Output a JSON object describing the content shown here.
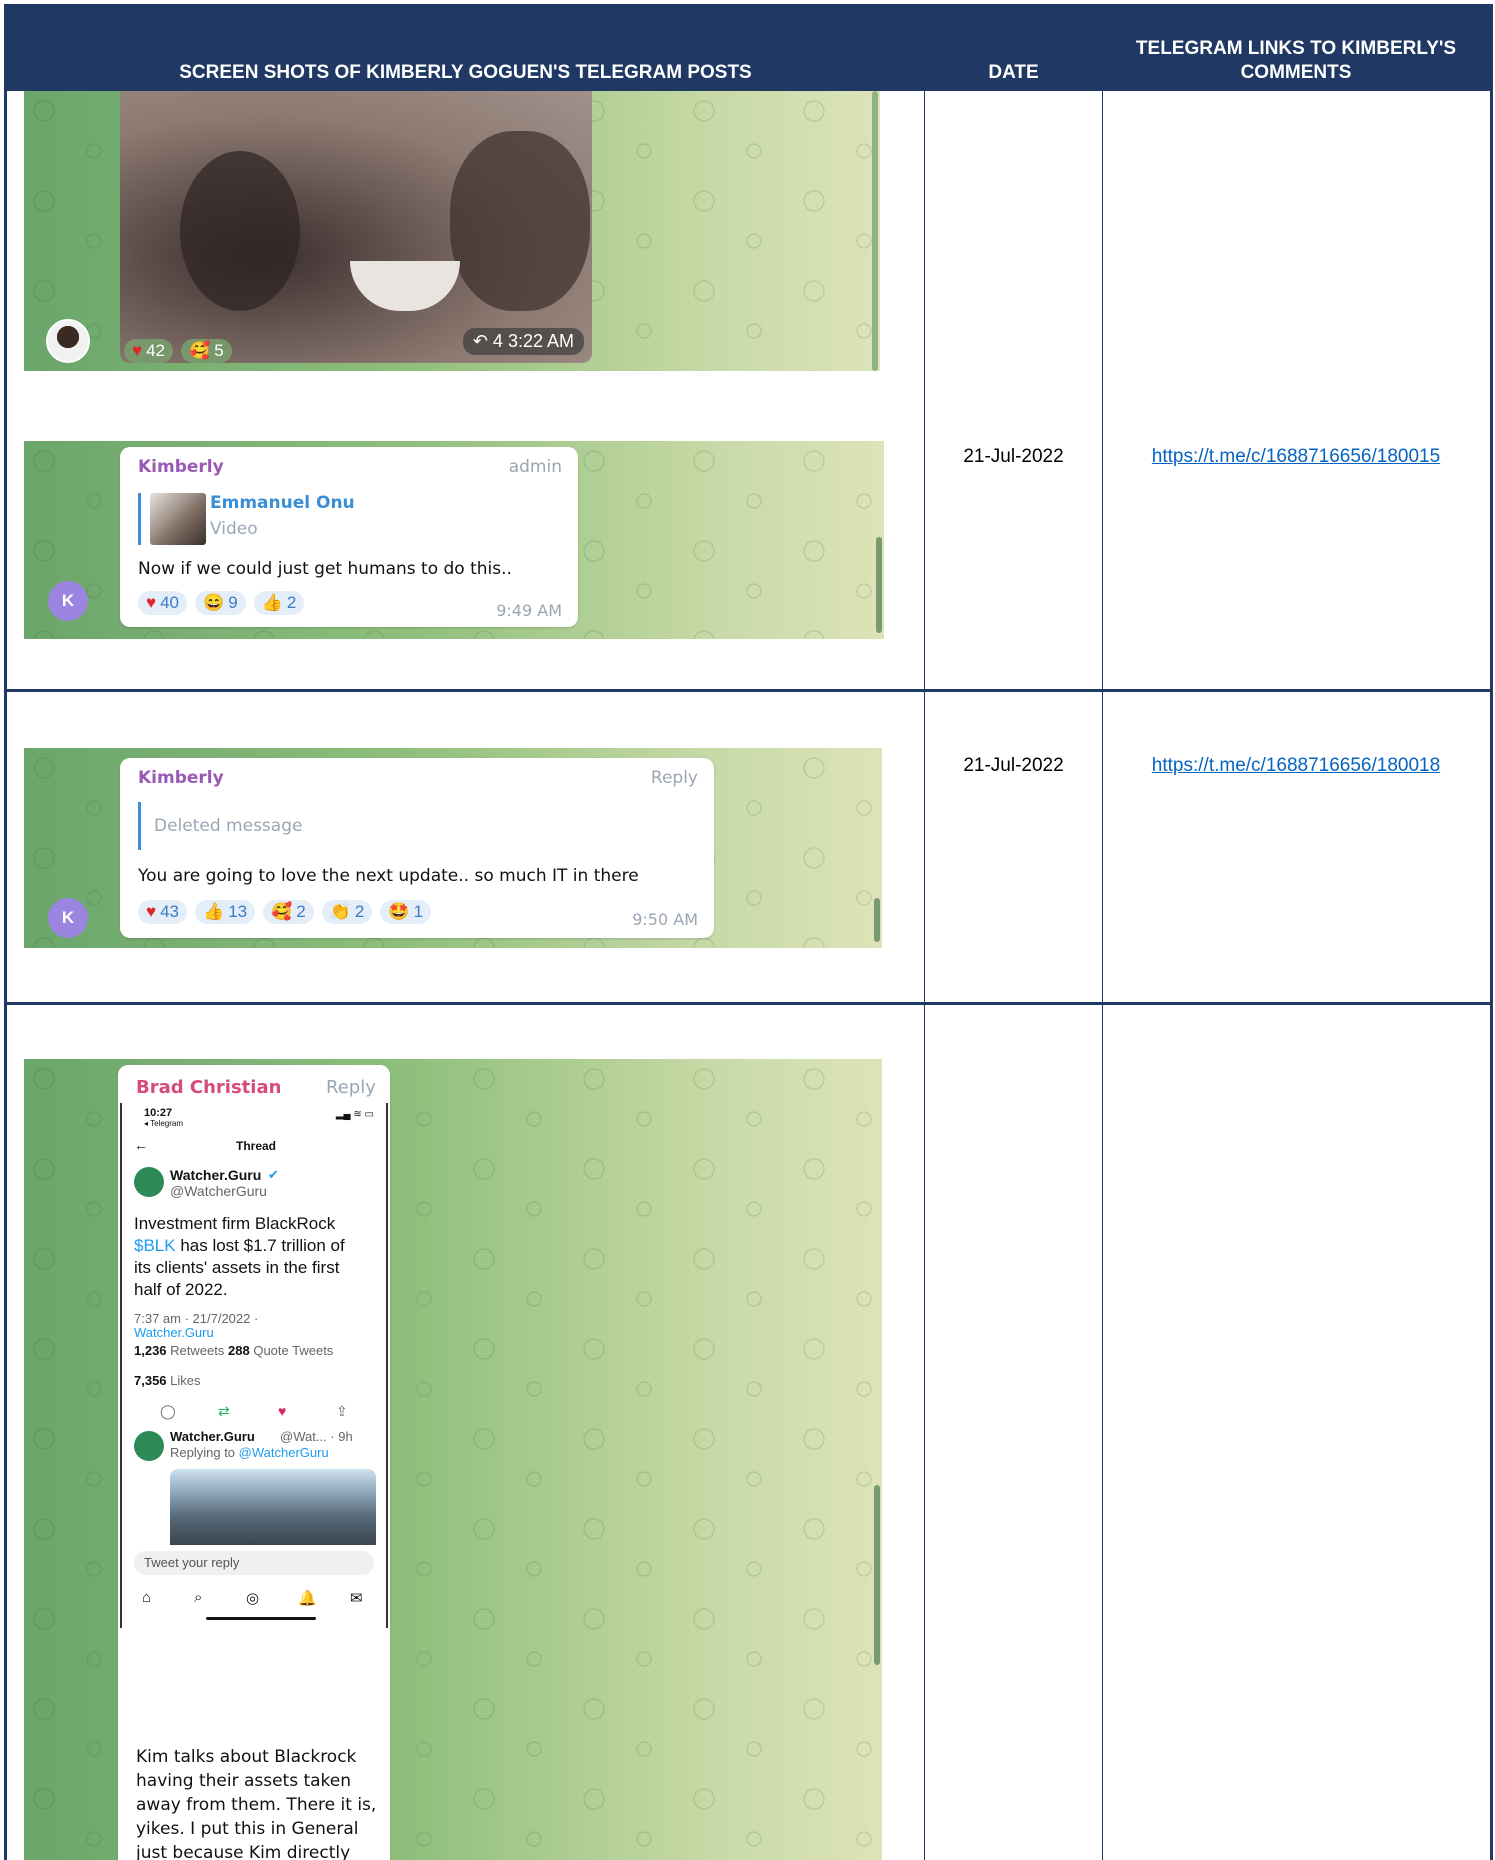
{
  "header": {
    "col1": "SCREEN SHOTS OF KIMBERLY GOGUEN'S TELEGRAM POSTS",
    "col2": "DATE",
    "col3": "TELEGRAM LINKS TO KIMBERLY'S COMMENTS"
  },
  "rows": [
    {
      "date": "21-Jul-2022",
      "link": "https://t.me/c/1688716656/180015",
      "video": {
        "forwards": "4",
        "time": "3:22 AM",
        "react_heart": "42",
        "react_2": "5"
      },
      "message": {
        "author": "Kimberly",
        "tag": "admin",
        "quote_name": "Emmanuel Onu",
        "quote_type": "Video",
        "text": "Now if we could just get humans to do this..",
        "time": "9:49 AM",
        "avatar_letter": "K",
        "reactions": [
          {
            "emoji": "♥",
            "count": "40"
          },
          {
            "emoji": "😄",
            "count": "9"
          },
          {
            "emoji": "👍",
            "count": "2"
          }
        ]
      }
    },
    {
      "date": "21-Jul-2022",
      "link": "https://t.me/c/1688716656/180018",
      "message": {
        "author": "Kimberly",
        "tag": "Reply",
        "quote_text": "Deleted message",
        "text": "You are going to love the next update.. so much IT in there",
        "time": "9:50 AM",
        "avatar_letter": "K",
        "reactions": [
          {
            "emoji": "♥",
            "count": "43"
          },
          {
            "emoji": "👍",
            "count": "13"
          },
          {
            "emoji": "🥰",
            "count": "2"
          },
          {
            "emoji": "👏",
            "count": "2"
          },
          {
            "emoji": "🤩",
            "count": "1"
          }
        ]
      }
    },
    {
      "date": "",
      "link": "",
      "message": {
        "author": "Brad Christian",
        "tag": "Reply",
        "phone_time": "10:27",
        "phone_app": "◂ Telegram",
        "thread_title": "Thread",
        "tweet_name": "Watcher.Guru",
        "tweet_handle": "@WatcherGuru",
        "tweet_body_1": "Investment firm BlackRock",
        "tweet_ticker": "$BLK",
        "tweet_body_2": " has lost $1.7 trillion of",
        "tweet_body_3": "its clients' assets in the first",
        "tweet_body_4": "half of 2022.",
        "tweet_meta": "7:37 am · 21/7/2022 ·",
        "tweet_source": "Watcher.Guru",
        "retweets": "1,236",
        "retweets_label": "Retweets",
        "quotes": "288",
        "quotes_label": "Quote Tweets",
        "likes": "7,356",
        "likes_label": "Likes",
        "reply_name": "Watcher.Guru",
        "reply_handle": "@Wat... · 9h",
        "replying_to": "Replying to",
        "replying_handle": "@WatcherGuru",
        "reply_placeholder": "Tweet your reply",
        "text_lines": [
          "Kim talks about Blackrock",
          "having their assets taken",
          "away from them.  There it is,",
          "yikes.  I put this in General",
          "just because Kim directly"
        ]
      }
    }
  ]
}
